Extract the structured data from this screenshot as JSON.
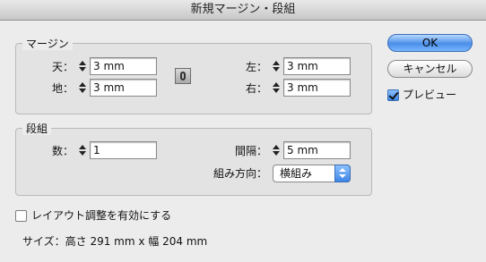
{
  "window": {
    "title": "新規マージン・段組"
  },
  "margin": {
    "title": "マージン",
    "top": {
      "label": "天：",
      "value": "3 mm"
    },
    "bottom": {
      "label": "地：",
      "value": "3 mm"
    },
    "left": {
      "label": "左：",
      "value": "3 mm"
    },
    "right": {
      "label": "右：",
      "value": "3 mm"
    },
    "link_icon": "chain-link-icon"
  },
  "columns": {
    "title": "段組",
    "count": {
      "label": "数：",
      "value": "1"
    },
    "gutter": {
      "label": "間隔：",
      "value": "5 mm"
    },
    "direction": {
      "label": "組み方向：",
      "value": "横組み"
    }
  },
  "buttons": {
    "ok": "OK",
    "cancel": "キャンセル"
  },
  "preview": {
    "label": "プレビュー",
    "checked": true
  },
  "adjust_layout": {
    "label": "レイアウト調整を有効にする",
    "checked": false
  },
  "size_text": "サイズ：高さ 291 mm x 幅 204 mm"
}
